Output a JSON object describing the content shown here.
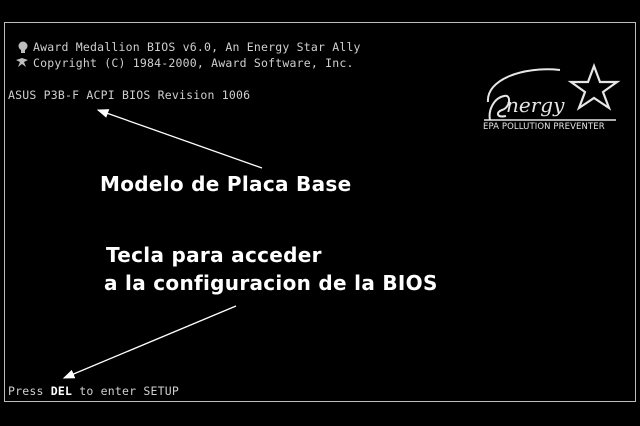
{
  "bios": {
    "line1": "Award Medallion BIOS v6.0, An Energy Star Ally",
    "line2": "Copyright (C) 1984-2000, Award Software, Inc.",
    "revision": "ASUS P3B-F ACPI BIOS Revision 1006",
    "prompt_before": "Press ",
    "prompt_key": "DEL",
    "prompt_after": " to enter SETUP"
  },
  "energy_logo": {
    "caption": "EPA POLLUTION PREVENTER",
    "icon": "energy-star-logo"
  },
  "annotations": {
    "board_label": "Modelo de Placa Base",
    "key_label_line1": "Tecla para acceder",
    "key_label_line2": "a la configuracion de la BIOS"
  },
  "colors": {
    "background": "#000000",
    "text": "#cfcfcf",
    "caption": "#ffffff"
  }
}
